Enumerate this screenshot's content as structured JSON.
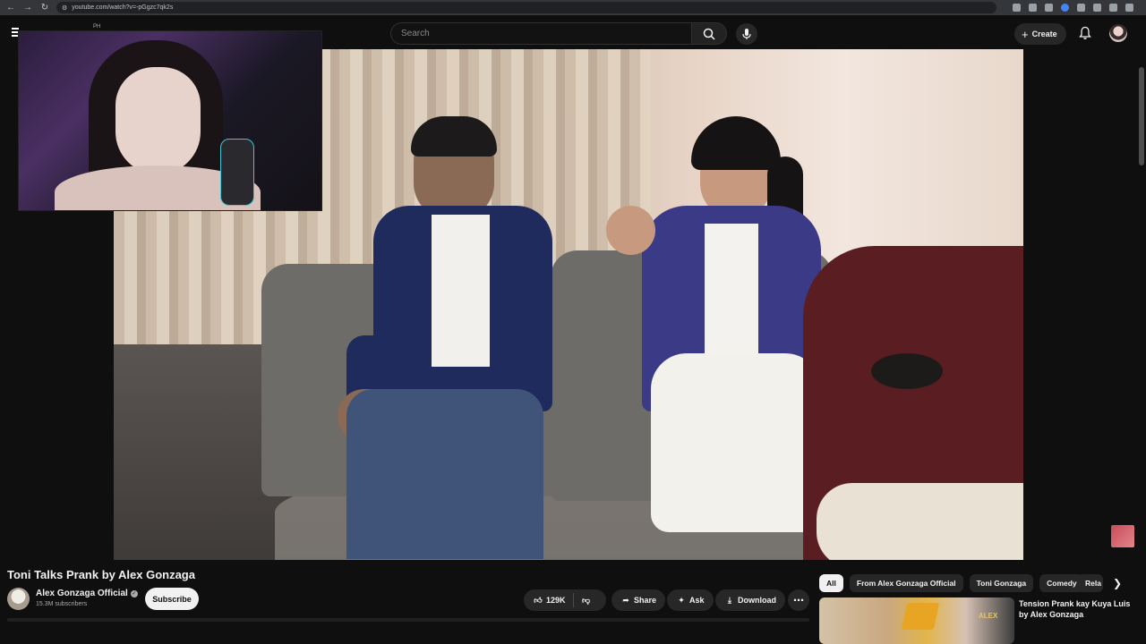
{
  "browser": {
    "url": "youtube.com/watch?v=-pGgzc7qk2s",
    "icons": [
      "back-icon",
      "forward-icon",
      "reload-icon",
      "zoom-icon",
      "cast-icon",
      "star-icon",
      "extension-icon",
      "profile-icon"
    ]
  },
  "header": {
    "logo_region": "PH",
    "search_placeholder": "Search",
    "create_label": "Create"
  },
  "video": {
    "title": "Toni Talks Prank by Alex Gonzaga"
  },
  "channel": {
    "name": "Alex Gonzaga Official",
    "subscribers": "15.3M subscribers",
    "subscribe_label": "Subscribe"
  },
  "actions": {
    "likes": "129K",
    "share_label": "Share",
    "ask_label": "Ask",
    "download_label": "Download"
  },
  "chips": [
    {
      "label": "All",
      "active": true
    },
    {
      "label": "From Alex Gonzaga Official",
      "active": false
    },
    {
      "label": "Toni Gonzaga",
      "active": false
    },
    {
      "label": "Comedy",
      "active": false
    },
    {
      "label": "Rela",
      "active": false
    }
  ],
  "recommendation": {
    "title": "Tension Prank kay Kuya Luis",
    "by": "by Alex Gonzaga",
    "thumb_text": "ALEX"
  },
  "colors": {
    "background": "#0f0f0f",
    "chip_active": "#f1f1f1",
    "pill": "#272727"
  }
}
